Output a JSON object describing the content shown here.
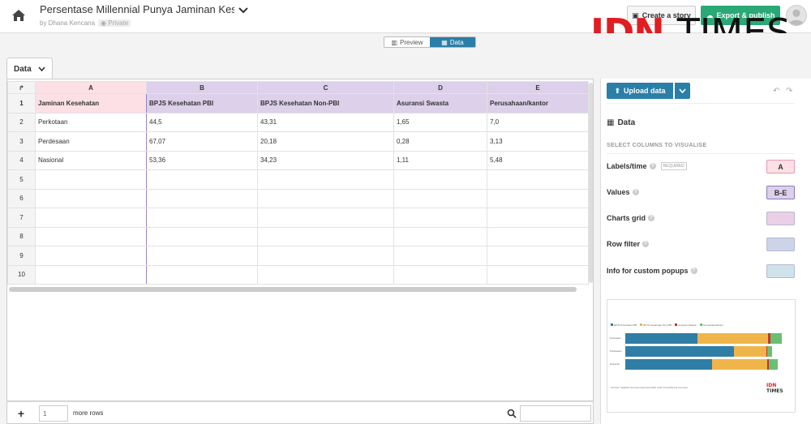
{
  "header": {
    "title": "Persentase Millennial Punya Jaminan Kesehat",
    "byline": "by Dhana Kencana",
    "privacy": "Private",
    "create_story": "Create a story",
    "export_publish": "Export & publish"
  },
  "watermark": {
    "idn": "IDN",
    "times": "TIMES"
  },
  "mode": {
    "preview": "Preview",
    "data": "Data"
  },
  "tab": {
    "label": "Data"
  },
  "sheet": {
    "columns": [
      "A",
      "B",
      "C",
      "D",
      "E"
    ],
    "rows": [
      {
        "n": "1",
        "cells": [
          "Jaminan Kesehatan",
          "BPJS Kesehatan PBI",
          "BPJS Kesehatan Non-PBI",
          "Asuransi Swasta",
          "Perusahaan/kantor"
        ]
      },
      {
        "n": "2",
        "cells": [
          "Perkotaan",
          "44,5",
          "43,31",
          "1,65",
          "7,0"
        ]
      },
      {
        "n": "3",
        "cells": [
          "Perdesaan",
          "67,07",
          "20,18",
          "0,28",
          "3,13"
        ]
      },
      {
        "n": "4",
        "cells": [
          "Nasional",
          "53,36",
          "34,23",
          "1,11",
          "5,48"
        ]
      },
      {
        "n": "5",
        "cells": [
          "",
          "",
          "",
          "",
          ""
        ]
      },
      {
        "n": "6",
        "cells": [
          "",
          "",
          "",
          "",
          ""
        ]
      },
      {
        "n": "7",
        "cells": [
          "",
          "",
          "",
          "",
          ""
        ]
      },
      {
        "n": "8",
        "cells": [
          "",
          "",
          "",
          "",
          ""
        ]
      },
      {
        "n": "9",
        "cells": [
          "",
          "",
          "",
          "",
          ""
        ]
      },
      {
        "n": "10",
        "cells": [
          "",
          "",
          "",
          "",
          ""
        ]
      }
    ]
  },
  "bottom": {
    "rows_value": "1",
    "more_rows": "more rows"
  },
  "panel": {
    "upload": "Upload data",
    "data_heading": "Data",
    "select_label": "SELECT COLUMNS TO VISUALISE",
    "options": [
      {
        "label": "Labels/time",
        "required": "REQUIRED",
        "value": "A",
        "color": "#fce0e6"
      },
      {
        "label": "Values",
        "value": "B-E",
        "color": "#dcd0ea"
      },
      {
        "label": "Charts grid",
        "value": "",
        "color": "#ebcfe6"
      },
      {
        "label": "Row filter",
        "value": "",
        "color": "#cdd3e8"
      },
      {
        "label": "Info for custom popups",
        "value": "",
        "color": "#cfe2ea"
      }
    ]
  },
  "thumbnail": {
    "legend": [
      "BPJS Kesehatan PBI",
      "BPJS Kesehatan Non-PBI",
      "Asuransi Swasta",
      "Perusahaan/kantor"
    ],
    "colors": [
      "#2f7ea6",
      "#f0b54a",
      "#c0392b",
      "#6bbf73"
    ],
    "categories": [
      "Perkotaan",
      "Perdesaan",
      "Nasional"
    ],
    "values": [
      [
        44.5,
        43.31,
        1.65,
        7.0
      ],
      [
        67.07,
        20.18,
        0.28,
        3.13
      ],
      [
        53.36,
        34.23,
        1.11,
        5.48
      ]
    ],
    "source": "Sumber: Statistik Pemuda Indonesia 2022 | IDN Times/Dhana Kencana",
    "logo_idn": "IDN",
    "logo_times": "TIMES"
  }
}
